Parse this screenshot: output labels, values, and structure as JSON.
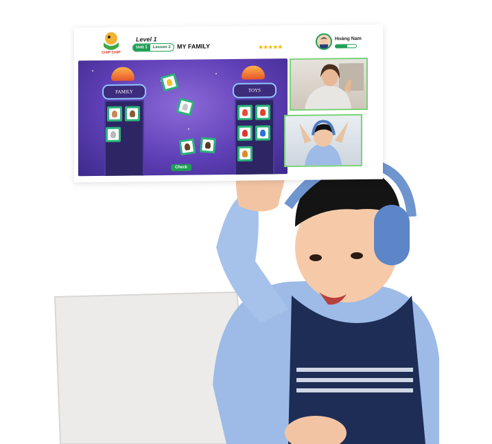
{
  "app": {
    "brand_text": "CHIP CHIP",
    "level": "Level 1",
    "unit": "Unit 1",
    "lesson": "Lesson 2",
    "title": "MY FAMILY",
    "rating_stars": "★★★★★",
    "rating_value": 4.5,
    "user_name": "Hoàng Nam",
    "progress": 0.55,
    "game": {
      "tower_left_label": "FAMILY",
      "tower_right_label": "TOYS",
      "check_label": "Check"
    }
  },
  "colors": {
    "accent_green": "#1f9d55",
    "game_purple": "#5f3fb6",
    "star_gold": "#f5b700"
  }
}
